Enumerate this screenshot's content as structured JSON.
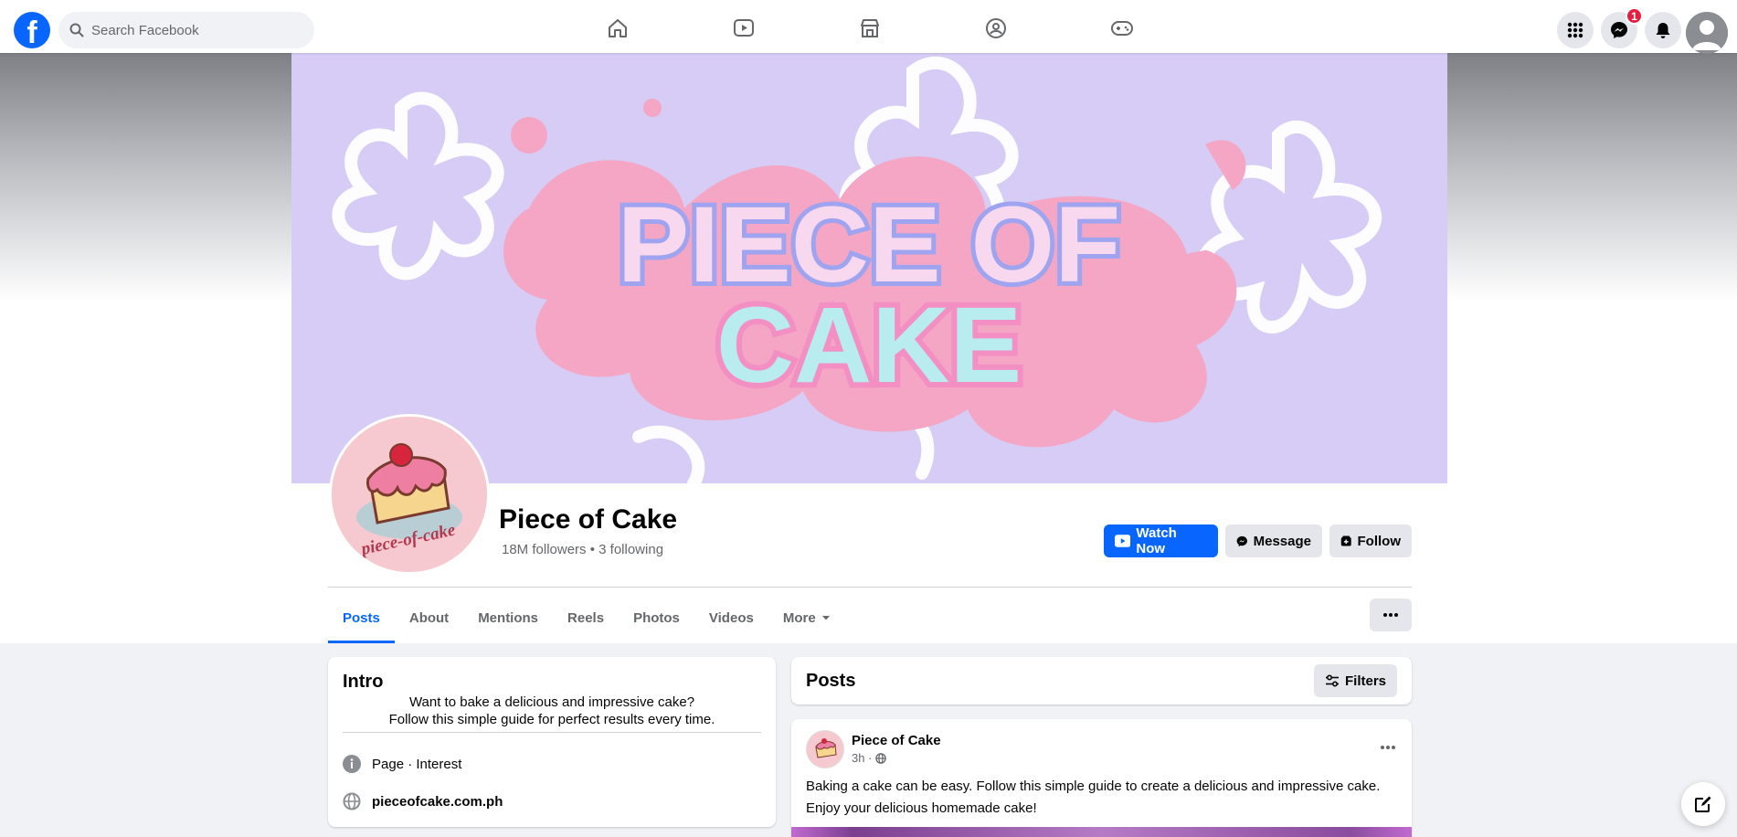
{
  "brand": {
    "logo_letter": "f",
    "accent": "#0866ff"
  },
  "search": {
    "placeholder": "Search Facebook"
  },
  "topnav": {
    "icons": [
      "home-icon",
      "video-icon",
      "marketplace-icon",
      "groups-icon",
      "gaming-icon"
    ],
    "messenger_badge": "1"
  },
  "cover": {
    "line1": "PIECE OF",
    "line2": "CAKE"
  },
  "profile": {
    "logo_text": "piece-of-cake",
    "name": "Piece of Cake",
    "followers": "18M followers",
    "separator": "•",
    "following": "3 following"
  },
  "actions": {
    "watch_now": "Watch Now",
    "message": "Message",
    "follow": "Follow"
  },
  "tabs": [
    "Posts",
    "About",
    "Mentions",
    "Reels",
    "Photos",
    "Videos",
    "More"
  ],
  "intro": {
    "title": "Intro",
    "bio_line1": "Want to bake a delicious and impressive cake?",
    "bio_line2": "Follow this simple guide for perfect results every time.",
    "category": "Page · Interest",
    "website": "pieceofcake.com.ph"
  },
  "posts_section": {
    "title": "Posts",
    "filters": "Filters"
  },
  "post": {
    "author": "Piece of Cake",
    "time": "3h ·",
    "text_line1": "Baking a cake can be easy. Follow this simple guide to create a delicious and impressive cake.",
    "text_line2": "Enjoy your delicious homemade cake!"
  }
}
